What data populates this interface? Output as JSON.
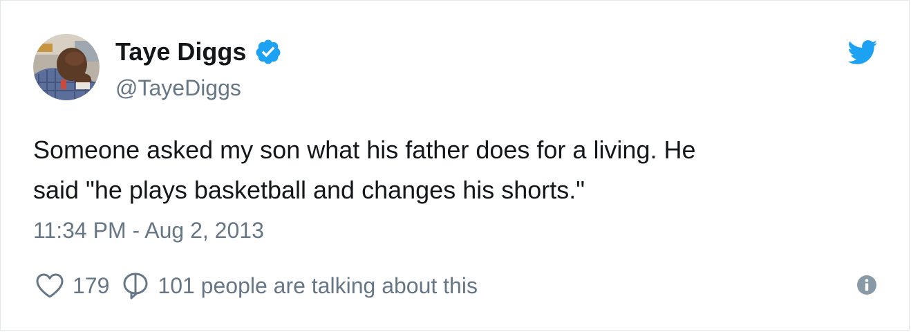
{
  "user": {
    "display_name": "Taye Diggs",
    "handle": "@TayeDiggs",
    "verified_icon": "verified-badge-icon",
    "avatar_icon": "avatar"
  },
  "tweet": {
    "text": "Someone asked my son what his father does for a living.  He\nsaid \"he plays basketball and changes his shorts.\"",
    "timestamp": "11:34 PM - Aug 2, 2013"
  },
  "actions": {
    "like_count": "179",
    "talking_text": "101 people are talking about this",
    "like_icon": "heart-icon",
    "reply_icon": "speech-bubble-icon",
    "info_icon": "info-icon"
  },
  "brand": {
    "logo_icon": "twitter-bird-icon",
    "accent_color": "#1da1f2",
    "muted_text_color": "#657786",
    "text_color": "#14171a"
  }
}
